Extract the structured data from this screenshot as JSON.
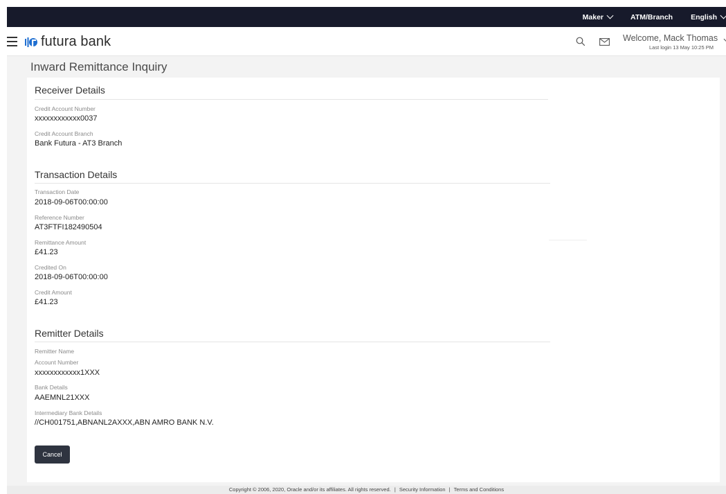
{
  "topbar": {
    "role": "Maker",
    "location": "ATM/Branch",
    "language": "English"
  },
  "header": {
    "brand": "futura bank",
    "welcome": "Welcome, Mack Thomas",
    "last_login": "Last login 13 May 10:25 PM"
  },
  "page": {
    "title": "Inward Remittance Inquiry"
  },
  "receiver": {
    "title": "Receiver Details",
    "credit_account_number_label": "Credit Account Number",
    "credit_account_number": "xxxxxxxxxxxx0037",
    "credit_account_branch_label": "Credit Account Branch",
    "credit_account_branch": "Bank Futura - AT3 Branch"
  },
  "transaction": {
    "title": "Transaction Details",
    "date_label": "Transaction Date",
    "date": "2018-09-06T00:00:00",
    "reference_label": "Reference Number",
    "reference": "AT3FTFI182490504",
    "remittance_amount_label": "Remittance Amount",
    "remittance_amount": "£41.23",
    "credited_on_label": "Credited On",
    "credited_on": "2018-09-06T00:00:00",
    "credit_amount_label": "Credit Amount",
    "credit_amount": "£41.23"
  },
  "remitter": {
    "title": "Remitter Details",
    "name_label": "Remitter Name",
    "account_number_label": "Account Number",
    "account_number": "xxxxxxxxxxxx1XXX",
    "bank_details_label": "Bank Details",
    "bank_details": "AAEMNL21XXX",
    "intermediary_label": "Intermediary Bank Details",
    "intermediary": "//CH001751,ABNANL2AXXX,ABN AMRO BANK N.V."
  },
  "actions": {
    "cancel": "Cancel"
  },
  "footer": {
    "copyright": "Copyright © 2006, 2020, Oracle and/or its affiliates. All rights reserved.",
    "separator": "|",
    "security": "Security Information",
    "terms": "Terms and Conditions"
  },
  "colors": {
    "topbar_bg": "#171a2b",
    "brand_blue": "#1f6fd1",
    "button_bg": "#2f3440"
  }
}
